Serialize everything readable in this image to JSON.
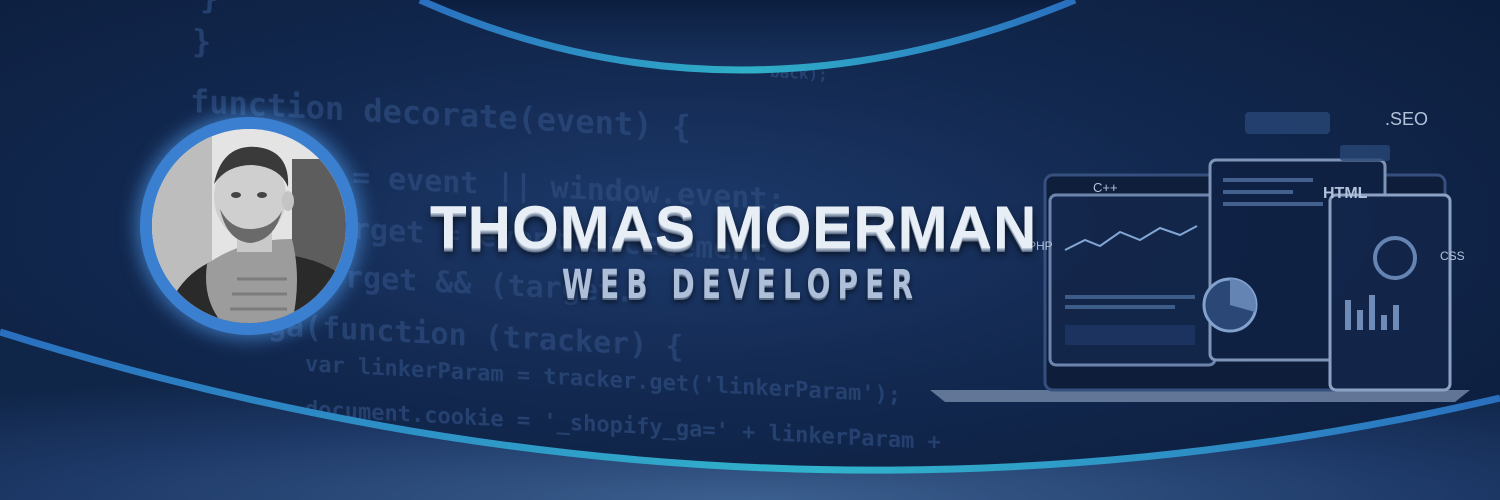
{
  "profile": {
    "name": "THOMAS MOERMAN",
    "role": "WEB DEVELOPER"
  },
  "background_code": [
    "}",
    "}",
    "function decorate(event) {",
    "= event || window.event;",
    "rget = event.srcElement",
    "rget && (target.",
    "ga(function (tracker) {",
    "var linkerParam = tracker.get('linkerParam');",
    "document.cookie = '_shopify_ga=' + linkerParam +",
    "back);"
  ],
  "device_labels": {
    "seo": ".SEO",
    "html": "HTML",
    "cpp": "C++",
    "css": "CSS",
    "php": "PHP"
  },
  "colors": {
    "background": "#12284f",
    "accent_arc": "#2f8fc9",
    "name_text": "#e8eef6",
    "role_text": "#aebfd9"
  }
}
